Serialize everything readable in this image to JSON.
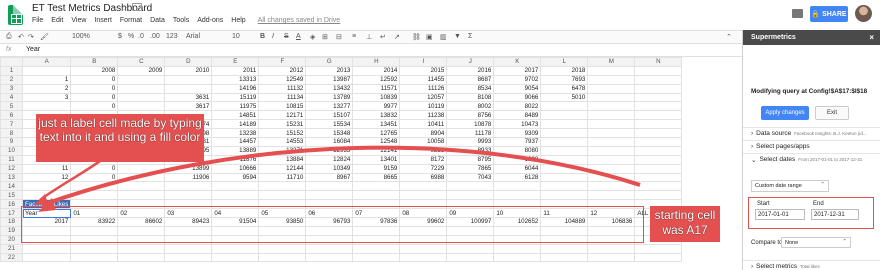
{
  "app": {
    "title": "ET Test Metrics Dashboard",
    "menus": [
      "File",
      "Edit",
      "View",
      "Insert",
      "Format",
      "Data",
      "Tools",
      "Add-ons",
      "Help"
    ],
    "saved_status": "All changes saved in Drive",
    "share_label": "SHARE"
  },
  "toolbar": {
    "zoom": "100%",
    "currency": "$",
    "percent": "%",
    "decimals_dec": ".0",
    "decimals_inc": ".00",
    "more_formats": "123",
    "font": "Arial",
    "font_size": "10",
    "bold": "B",
    "italic": "I",
    "strike": "S",
    "text_color": "A"
  },
  "formula_bar": {
    "fx": "fx",
    "value": "Year"
  },
  "columns": [
    "",
    "A",
    "B",
    "C",
    "D",
    "E",
    "F",
    "G",
    "H",
    "I",
    "J",
    "K",
    "L",
    "M",
    "N"
  ],
  "rows": [
    {
      "n": "1",
      "cells": [
        "",
        "2008",
        "2009",
        "2010",
        "2011",
        "2012",
        "2013",
        "2014",
        "2015",
        "2016",
        "2017",
        "2018",
        "",
        ""
      ]
    },
    {
      "n": "2",
      "cells": [
        "1",
        "0",
        "",
        "",
        "13313",
        "12549",
        "13987",
        "12592",
        "11455",
        "8687",
        "9702",
        "7693",
        "",
        ""
      ]
    },
    {
      "n": "3",
      "cells": [
        "2",
        "0",
        "",
        "",
        "14196",
        "11132",
        "13432",
        "11571",
        "11126",
        "8534",
        "9054",
        "6478",
        "",
        ""
      ]
    },
    {
      "n": "4",
      "cells": [
        "3",
        "0",
        "",
        "3631",
        "15119",
        "11134",
        "13789",
        "10839",
        "12057",
        "8108",
        "9066",
        "5010",
        "",
        ""
      ]
    },
    {
      "n": "5",
      "cells": [
        "",
        "0",
        "",
        "3617",
        "11975",
        "10815",
        "13277",
        "9977",
        "10119",
        "8002",
        "8022",
        "",
        "",
        ""
      ]
    },
    {
      "n": "6",
      "cells": [
        "",
        "",
        "",
        "",
        "14851",
        "12171",
        "15107",
        "13832",
        "11238",
        "8756",
        "8489",
        "",
        "",
        ""
      ]
    },
    {
      "n": "7",
      "cells": [
        "",
        "",
        "",
        "4474",
        "14189",
        "15231",
        "15534",
        "13451",
        "10411",
        "10878",
        "10473",
        "",
        "",
        ""
      ]
    },
    {
      "n": "8",
      "cells": [
        "",
        "",
        "",
        "6398",
        "13238",
        "15152",
        "15348",
        "12765",
        "8904",
        "11178",
        "9309",
        "",
        "",
        ""
      ]
    },
    {
      "n": "9",
      "cells": [
        "",
        "",
        "",
        "16131",
        "14457",
        "14553",
        "16084",
        "12548",
        "10058",
        "9993",
        "7937",
        "",
        "",
        ""
      ]
    },
    {
      "n": "10",
      "cells": [
        "9",
        "",
        "",
        "14195",
        "13889",
        "13271",
        "12935",
        "12141",
        "9258",
        "8933",
        "8080",
        "",
        "",
        ""
      ]
    },
    {
      "n": "11",
      "cells": [
        "10",
        "0",
        "",
        "",
        "11876",
        "13884",
        "12824",
        "13401",
        "8172",
        "8795",
        "6898",
        "",
        "",
        ""
      ]
    },
    {
      "n": "12",
      "cells": [
        "11",
        "0",
        "",
        "13899",
        "10666",
        "12144",
        "10349",
        "9159",
        "7229",
        "7865",
        "6044",
        "",
        "",
        ""
      ]
    },
    {
      "n": "13",
      "cells": [
        "12",
        "0",
        "",
        "11906",
        "9594",
        "11710",
        "8967",
        "8665",
        "6988",
        "7043",
        "6128",
        "",
        "",
        ""
      ]
    },
    {
      "n": "14",
      "cells": [
        "",
        "",
        "",
        "",
        "",
        "",
        "",
        "",
        "",
        "",
        "",
        "",
        "",
        ""
      ]
    },
    {
      "n": "15",
      "cells": [
        "",
        "",
        "",
        "",
        "",
        "",
        "",
        "",
        "",
        "",
        "",
        "",
        "",
        ""
      ]
    },
    {
      "n": "16",
      "cells": [
        "Facebook Likes",
        "",
        "",
        "",
        "",
        "",
        "",
        "",
        "",
        "",
        "",
        "",
        "",
        ""
      ]
    },
    {
      "n": "17",
      "cells": [
        "Year",
        "01",
        "02",
        "03",
        "04",
        "05",
        "06",
        "07",
        "08",
        "09",
        "10",
        "11",
        "12",
        "ALL"
      ]
    },
    {
      "n": "18",
      "cells": [
        "2017",
        "83922",
        "86602",
        "89423",
        "91504",
        "93850",
        "96793",
        "97836",
        "99602",
        "100997",
        "102652",
        "104889",
        "106836",
        ""
      ]
    },
    {
      "n": "19",
      "cells": [
        "",
        "",
        "",
        "",
        "",
        "",
        "",
        "",
        "",
        "",
        "",
        "",
        "",
        ""
      ]
    },
    {
      "n": "20",
      "cells": [
        "",
        "",
        "",
        "",
        "",
        "",
        "",
        "",
        "",
        "",
        "",
        "",
        "",
        ""
      ]
    },
    {
      "n": "21",
      "cells": [
        "",
        "",
        "",
        "",
        "",
        "",
        "",
        "",
        "",
        "",
        "",
        "",
        "",
        ""
      ]
    },
    {
      "n": "22",
      "cells": [
        "",
        "",
        "",
        "",
        "",
        "",
        "",
        "",
        "",
        "",
        "",
        "",
        "",
        ""
      ]
    }
  ],
  "panel": {
    "title": "Supermetrics",
    "status": "Modifying query at Config!$A$17:$I$18",
    "apply_label": "Apply changes",
    "exit_label": "Exit",
    "data_source_label": "Data source",
    "data_source_value": "Facebook Insights: B.J. Keeton (id...",
    "pages_label": "Select pages/apps",
    "dates_label": "Select dates",
    "dates_range_text": "From 2017-01-01 to 2017-12-31",
    "range_select": "Custom date range",
    "start_label": "Start",
    "end_label": "End",
    "start_value": "2017-01-01",
    "end_value": "2017-12-31",
    "compare_label": "Compare to",
    "compare_value": "None",
    "metrics_label": "Select metrics",
    "metrics_small": "Total likes"
  },
  "annotations": {
    "label_cell_note": "just a label cell made by typing text into it and using a fill color",
    "starting_cell_note": "starting cell was A17"
  },
  "colors": {
    "accent": "#4285f4",
    "annotation": "#e4504f",
    "fill_cell": "#3d6db5"
  }
}
